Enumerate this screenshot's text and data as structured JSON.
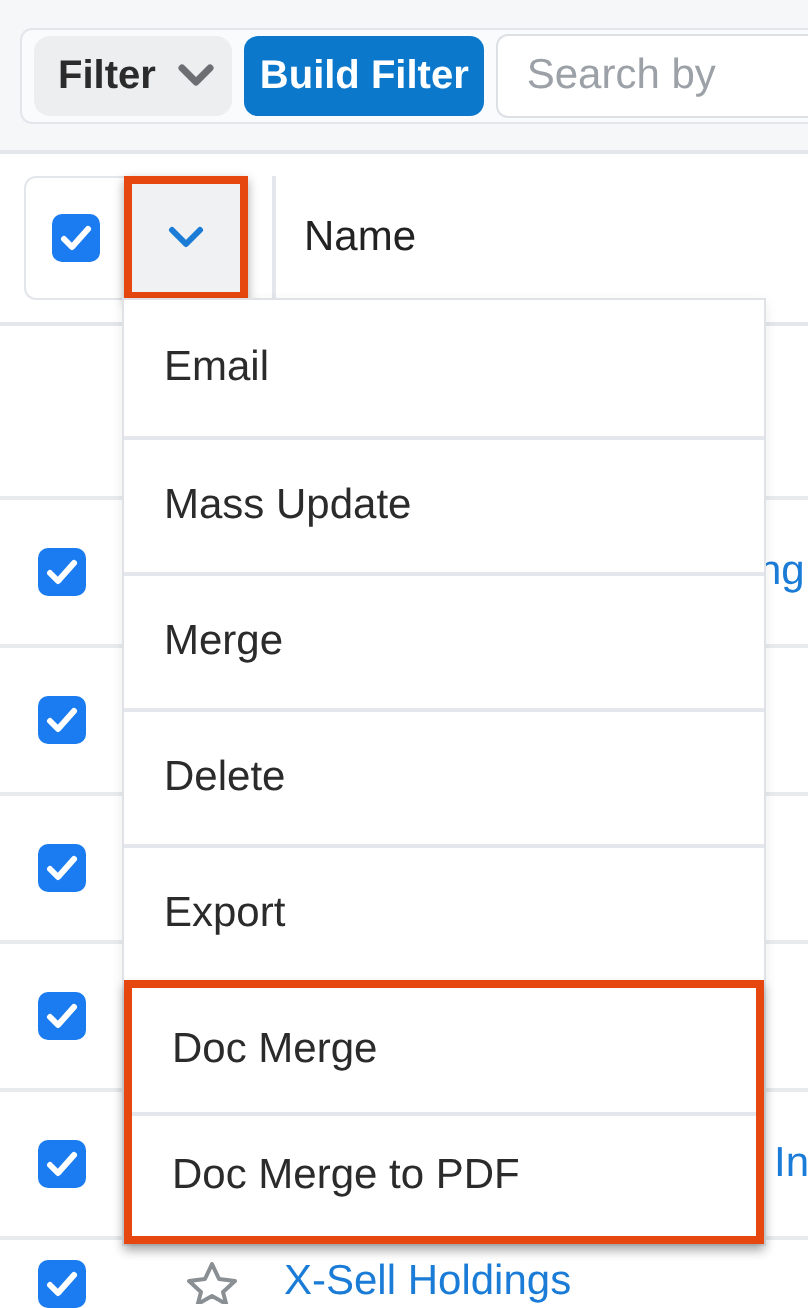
{
  "toolbar": {
    "filter_button": "Filter",
    "build_filter_button": "Build Filter",
    "search": {
      "placeholder": "Search by"
    }
  },
  "header": {
    "select_all_checked": true,
    "dropdown_highlighted": true,
    "column": "Name"
  },
  "actions_menu": {
    "items": [
      {
        "label": "Email",
        "highlighted": false
      },
      {
        "label": "Mass Update",
        "highlighted": false
      },
      {
        "label": "Merge",
        "highlighted": false
      },
      {
        "label": "Delete",
        "highlighted": false
      },
      {
        "label": "Export",
        "highlighted": false
      },
      {
        "label": "Doc Merge",
        "highlighted": true
      },
      {
        "label": "Doc Merge to PDF",
        "highlighted": true
      }
    ]
  },
  "rows": [
    {
      "checked": true,
      "kind": "fragment",
      "name": "ng"
    },
    {
      "checked": true,
      "kind": "hidden"
    },
    {
      "checked": true,
      "kind": "hidden"
    },
    {
      "checked": true,
      "kind": "hidden"
    },
    {
      "checked": true,
      "kind": "fragment",
      "name": "In"
    },
    {
      "checked": true,
      "kind": "full",
      "name": "X-Sell Holdings"
    }
  ]
}
